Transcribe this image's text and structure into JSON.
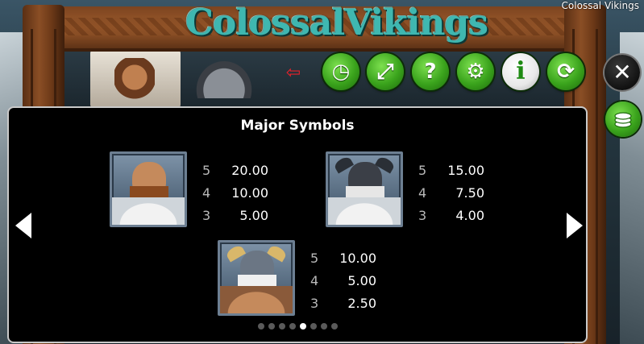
{
  "window_title": "Colossal Vikings",
  "game_logo": {
    "part1": "Colossal",
    "part2": "Vikings"
  },
  "toolbar": {
    "exit_icon": "exit-door-icon",
    "buttons": [
      {
        "name": "history",
        "icon": "clock-icon",
        "glyph": "◷"
      },
      {
        "name": "fullscreen",
        "icon": "fullscreen-icon",
        "glyph": "⤢"
      },
      {
        "name": "help",
        "icon": "question-icon",
        "glyph": "?"
      },
      {
        "name": "settings",
        "icon": "gear-icon",
        "glyph": "⚙"
      },
      {
        "name": "info",
        "icon": "info-icon",
        "glyph": "i"
      },
      {
        "name": "autoplay",
        "icon": "autoplay-icon",
        "glyph": "⟳"
      }
    ],
    "close_glyph": "✕",
    "coins_icon": "coins-icon"
  },
  "paytable": {
    "title": "Major Symbols",
    "symbols": [
      {
        "id": "viking-brown-beard",
        "pays": [
          {
            "count": "5",
            "value": "20.00"
          },
          {
            "count": "4",
            "value": "10.00"
          },
          {
            "count": "3",
            "value": "5.00"
          }
        ]
      },
      {
        "id": "viking-masked-helmet",
        "pays": [
          {
            "count": "5",
            "value": "15.00"
          },
          {
            "count": "4",
            "value": "7.50"
          },
          {
            "count": "3",
            "value": "4.00"
          }
        ]
      },
      {
        "id": "viking-white-beard-horned",
        "pays": [
          {
            "count": "5",
            "value": "10.00"
          },
          {
            "count": "4",
            "value": "5.00"
          },
          {
            "count": "3",
            "value": "2.50"
          }
        ]
      }
    ],
    "page_index": 5,
    "page_count": 8
  },
  "colors": {
    "accent_green": "#3aa31c",
    "logo_teal": "#3fb7b0",
    "panel_border": "#c9c9c9"
  }
}
